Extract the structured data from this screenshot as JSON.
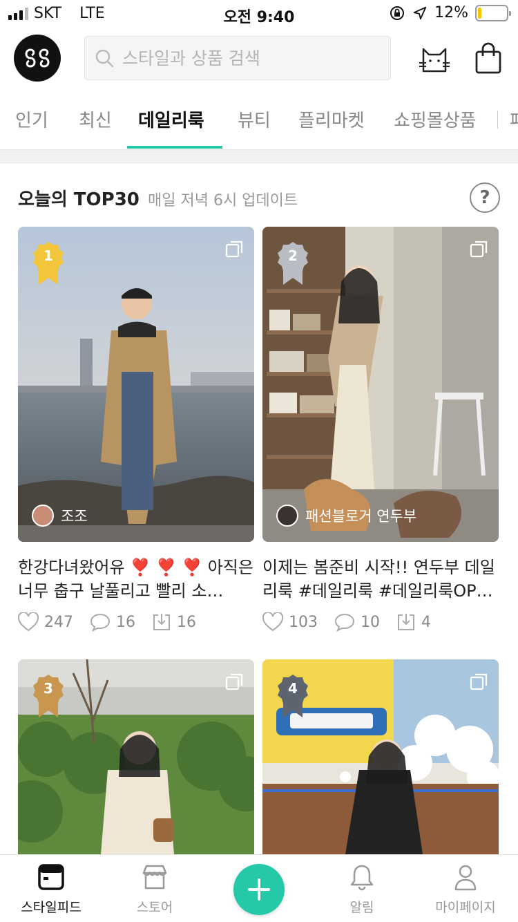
{
  "status_bar": {
    "carrier": "SKT",
    "network": "LTE",
    "time": "오전 9:40",
    "battery": "12%",
    "battery_level": 0.12
  },
  "search": {
    "placeholder": "스타일과 상품 검색"
  },
  "tabs": [
    {
      "label": "인기"
    },
    {
      "label": "최신"
    },
    {
      "label": "데일리룩",
      "active": true
    },
    {
      "label": "뷰티"
    },
    {
      "label": "플리마켓"
    },
    {
      "label": "쇼핑몰상품"
    },
    {
      "label": "패"
    }
  ],
  "section": {
    "title": "오늘의 TOP30",
    "subtitle": "매일 저녁 6시 업데이트",
    "help": "?"
  },
  "cards": [
    {
      "rank": "1",
      "author": "조조",
      "caption": "한강다녀왔어유 ❣️ ❣️ ❣️ 아직은 너무 춥구 날풀리고 빨리 소…",
      "likes": "247",
      "comments": "16",
      "saves": "16",
      "badge_color": "#f2c53a"
    },
    {
      "rank": "2",
      "author": "패션블로거 연두부",
      "caption": "이제는 봄준비 시작!! 연두부 데일리룩 #데일리룩 #데일리룩OP…",
      "likes": "103",
      "comments": "10",
      "saves": "4",
      "badge_color": "#b9bcc2"
    },
    {
      "rank": "3",
      "badge_color": "#c8964f"
    },
    {
      "rank": "4",
      "badge_color": "#5d6470"
    }
  ],
  "bottom_nav": [
    {
      "label": "스타일피드",
      "icon": "feed-icon",
      "active": true
    },
    {
      "label": "스토어",
      "icon": "store-icon"
    },
    {
      "label": "",
      "icon": "plus-icon"
    },
    {
      "label": "알림",
      "icon": "bell-icon"
    },
    {
      "label": "마이페이지",
      "icon": "person-icon"
    }
  ],
  "colors": {
    "accent": "#26c9a7"
  }
}
